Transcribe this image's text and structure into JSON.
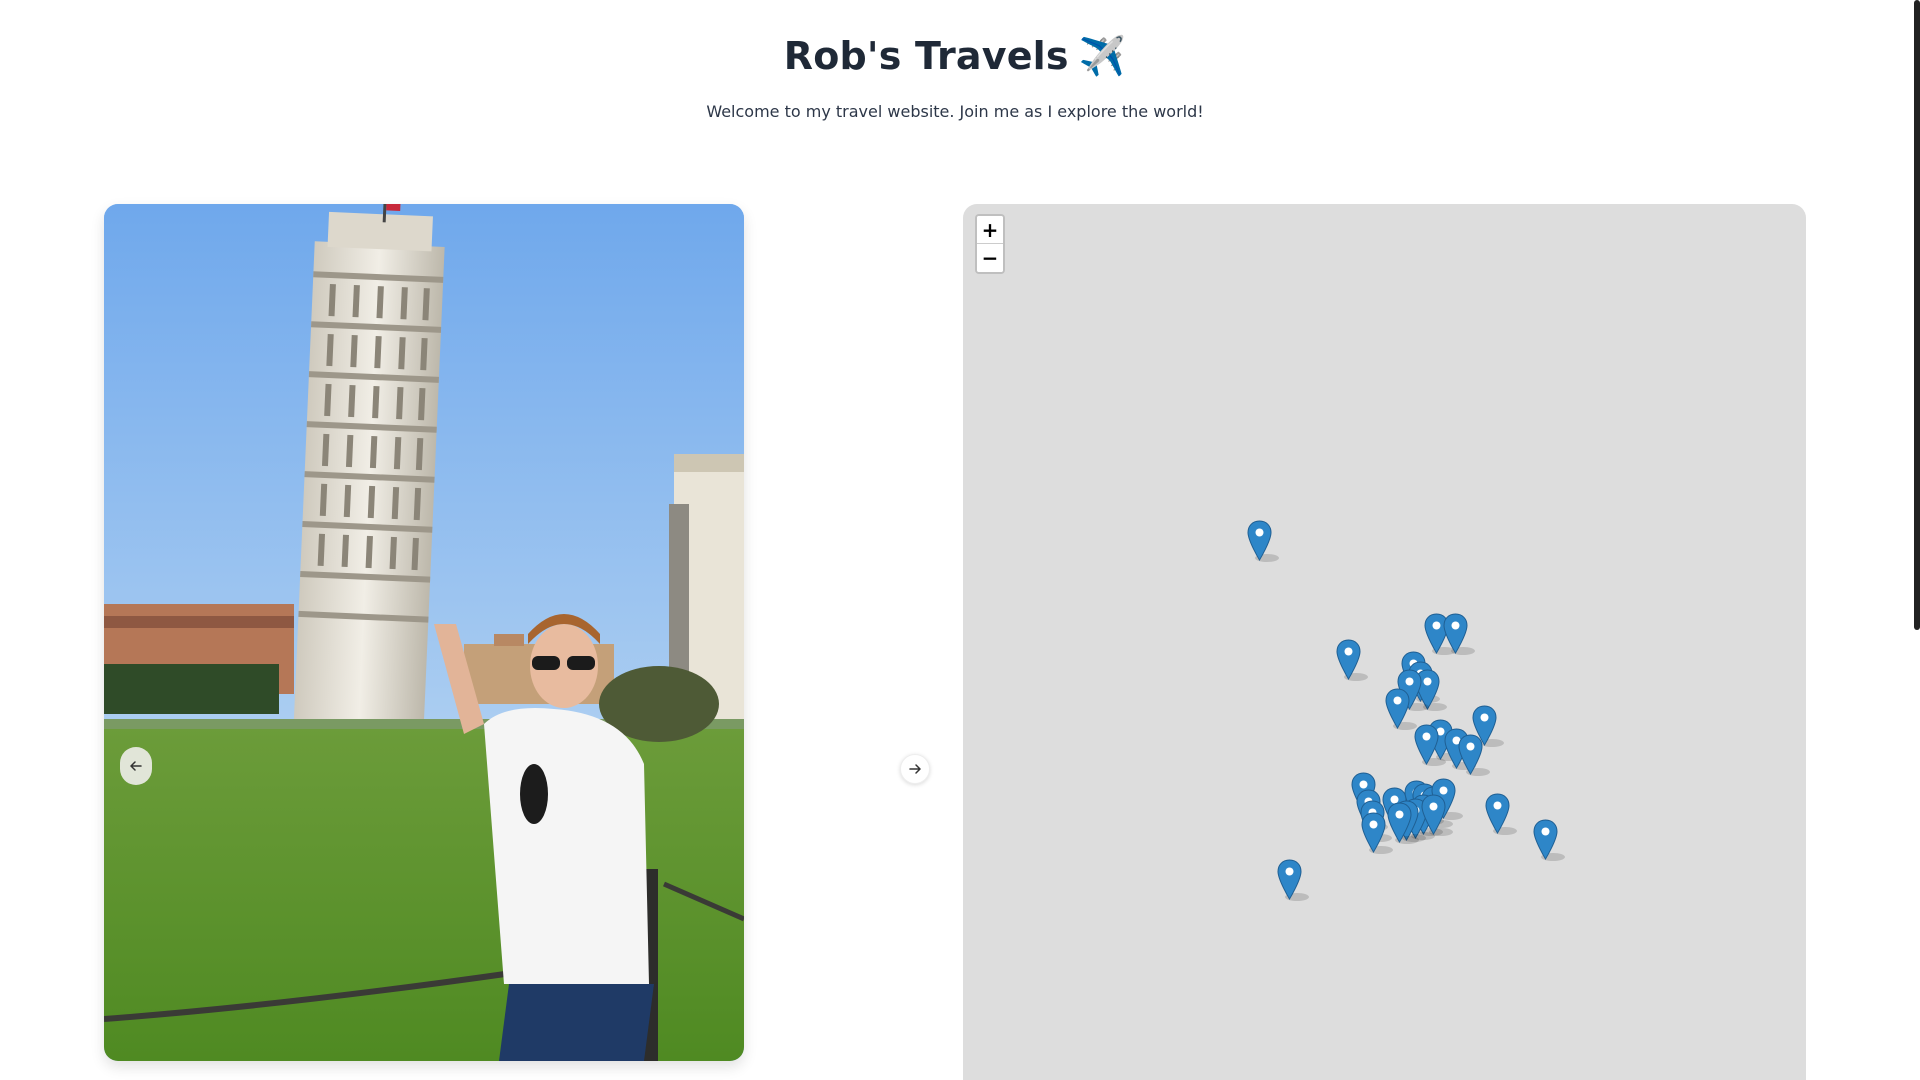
{
  "header": {
    "title": "Rob's Travels",
    "title_emoji": "✈️",
    "subtitle": "Welcome to my travel website. Join me as I explore the world!"
  },
  "gallery": {
    "photo_icon": "leaning-tower-of-pisa-photo",
    "prev_icon": "arrow-left-icon",
    "next_icon": "arrow-right-icon"
  },
  "map": {
    "zoom_in_label": "+",
    "zoom_out_label": "−",
    "marker_icon": "map-pin-icon",
    "marker_color": "#2e86c8",
    "marker_count": 31
  },
  "colors": {
    "title": "#1f2937",
    "map_background": "#dddddd",
    "marker": "#2e86c8"
  }
}
